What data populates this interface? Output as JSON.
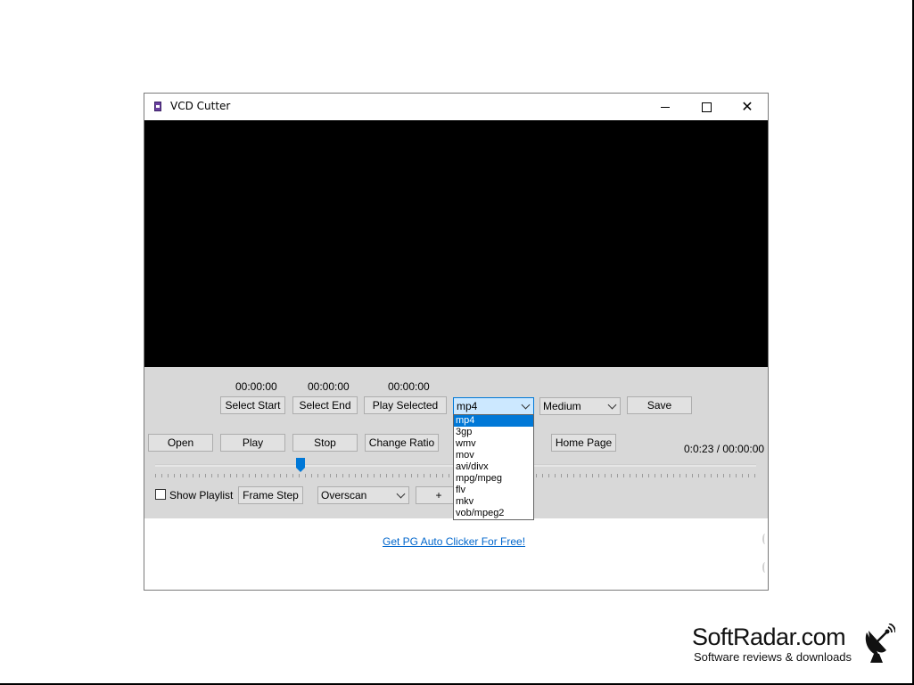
{
  "window": {
    "title": "VCD Cutter",
    "minimize_icon": "minimize-icon",
    "maximize_icon": "maximize-icon",
    "close_icon": "close-icon",
    "close_glyph": "✕"
  },
  "selection": {
    "start_time": "00:00:00",
    "end_time": "00:00:00",
    "selected_time": "00:00:00",
    "select_start_label": "Select Start",
    "select_end_label": "Select End",
    "play_selected_label": "Play Selected"
  },
  "format": {
    "selected": "mp4",
    "options": [
      "mp4",
      "3gp",
      "wmv",
      "mov",
      "avi/divx",
      "mpg/mpeg",
      "flv",
      "mkv",
      "vob/mpeg2"
    ],
    "highlighted_index": 0
  },
  "quality": {
    "selected": "Medium"
  },
  "save_label": "Save",
  "playback": {
    "open_label": "Open",
    "play_label": "Play",
    "stop_label": "Stop",
    "change_ratio_label": "Change Ratio",
    "home_page_label": "Home Page",
    "time_display": "0:0:23 /  00:00:00",
    "slider_position": 0.24
  },
  "bottom_controls": {
    "show_playlist_label": "Show Playlist",
    "show_playlist_checked": false,
    "frame_step_label": "Frame Step",
    "scaling_selected": "Overscan",
    "plus_label": "+"
  },
  "ad": {
    "link_text": "Get PG Auto Clicker For Free!"
  },
  "watermark": {
    "name": "SoftRadar.com",
    "tagline": "Software reviews & downloads",
    "icon": "satellite-dish-icon"
  },
  "colors": {
    "control_bg": "#d8d8d8",
    "highlight": "#0078d7",
    "link": "#0066cc",
    "slider_thumb": "#0078d7"
  }
}
